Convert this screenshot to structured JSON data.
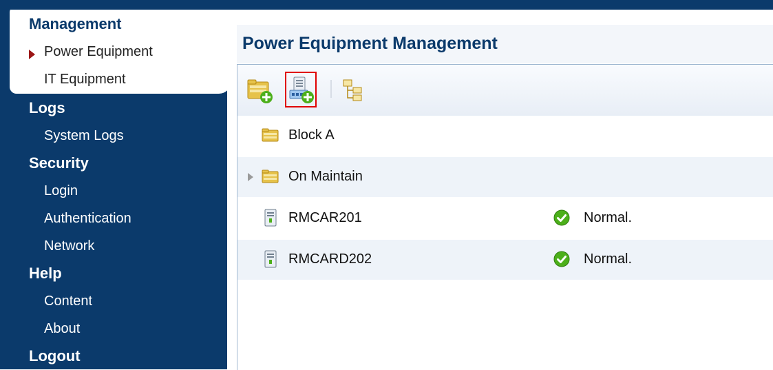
{
  "sidebar": {
    "sections": [
      {
        "title": "Management",
        "items": [
          "Power Equipment",
          "IT Equipment"
        ]
      },
      {
        "title": "Logs",
        "items": [
          "System Logs"
        ]
      },
      {
        "title": "Security",
        "items": [
          "Login",
          "Authentication",
          "Network"
        ]
      },
      {
        "title": "Help",
        "items": [
          "Content",
          "About"
        ]
      },
      {
        "title": "Logout",
        "items": []
      }
    ],
    "active_item": "Power Equipment"
  },
  "main": {
    "title": "Power Equipment Management",
    "toolbar": {
      "buttons": [
        {
          "icon": "folder-add-icon"
        },
        {
          "icon": "device-add-icon",
          "highlighted": true
        },
        {
          "icon": "tree-view-icon"
        }
      ]
    },
    "tree": [
      {
        "type": "group",
        "label": "Block A",
        "expandable": false
      },
      {
        "type": "group",
        "label": "On Maintain",
        "expandable": true
      },
      {
        "type": "device",
        "label": "RMCAR201",
        "status": "Normal."
      },
      {
        "type": "device",
        "label": "RMCARD202",
        "status": "Normal."
      }
    ]
  },
  "colors": {
    "sidebar_bg": "#0b3a6b",
    "title_text": "#0b3a6b",
    "active_arrow": "#9b1616",
    "highlight_outline": "#e00000",
    "status_ok": "#4caf1a",
    "row_alt": "#eef3f9"
  }
}
